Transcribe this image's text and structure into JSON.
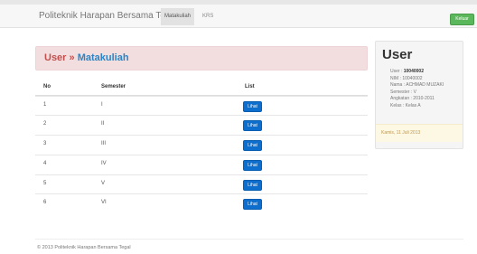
{
  "navbar": {
    "brand": "Politeknik Harapan Bersama Tegal",
    "tabs": [
      {
        "label": "Matakuliah",
        "active": true
      },
      {
        "label": "KRS",
        "active": false
      }
    ],
    "logout_label": "Keluar"
  },
  "header": {
    "title_main": "User",
    "separator": "»",
    "title_sub": "Matakuliah"
  },
  "table": {
    "columns": [
      "No",
      "Semester",
      "List"
    ],
    "rows": [
      {
        "no": "1",
        "semester": "I",
        "action": "Lihat"
      },
      {
        "no": "2",
        "semester": "II",
        "action": "Lihat"
      },
      {
        "no": "3",
        "semester": "III",
        "action": "Lihat"
      },
      {
        "no": "4",
        "semester": "IV",
        "action": "Lihat"
      },
      {
        "no": "5",
        "semester": "V",
        "action": "Lihat"
      },
      {
        "no": "6",
        "semester": "VI",
        "action": "Lihat"
      }
    ]
  },
  "sidebar": {
    "title": "User",
    "user_label": "User :",
    "user_value": "10040002",
    "nim": "NIM : 10040002",
    "nama": "Nama : ACHMAD MUZAKI",
    "semester": "Semester : V",
    "angkatan": "Angkatan : 2010-2011",
    "kelas": "Kelas : Kelas A",
    "date": "Kamis, 11 Juli 2013"
  },
  "footer": {
    "text": "© 2013 Politeknik Harapan Bersama Tegal"
  },
  "colors": {
    "alert_bg": "#f2dede",
    "title_red": "#c0504d",
    "title_blue": "#2a84c7",
    "button_blue": "#0d6ecd",
    "logout_green": "#5bb75b",
    "date_bg": "#fcf8e3"
  }
}
